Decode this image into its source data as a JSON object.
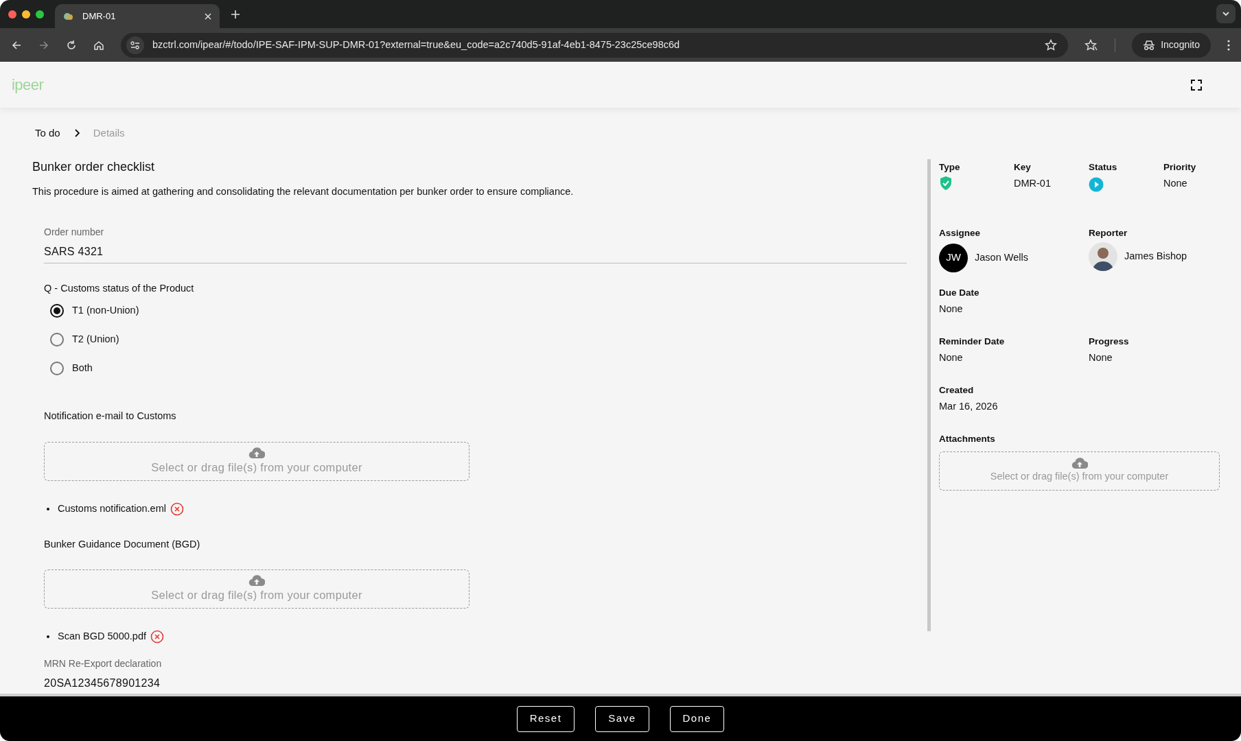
{
  "browser": {
    "tab_title": "DMR-01",
    "url": "bzctrl.com/ipear/#/todo/IPE-SAF-IPM-SUP-DMR-01?external=true&eu_code=a2c740d5-91af-4eb1-8475-23c25ce98c6d",
    "profile": "Incognito"
  },
  "app": {
    "logo": "ipeer"
  },
  "breadcrumb": [
    {
      "label": "To do",
      "current": false
    },
    {
      "label": "Details",
      "current": true
    }
  ],
  "title": "Bunker order checklist",
  "description": "This procedure is aimed at gathering and consolidating the relevant documentation per bunker order to ensure compliance.",
  "form": [
    {
      "kind": "text",
      "label": "Order number",
      "value": "SARS 4321"
    },
    {
      "kind": "radio",
      "label": "Q - Customs status of the Product",
      "options": [
        {
          "label": "T1 (non-Union)",
          "selected": true
        },
        {
          "label": "T2 (Union)",
          "selected": false
        },
        {
          "label": "Both",
          "selected": false
        }
      ]
    },
    {
      "kind": "upload",
      "label": "Notification e-mail to Customs",
      "hint": "Select or drag file(s) from your computer",
      "files": [
        "Customs notification.eml"
      ]
    },
    {
      "kind": "upload",
      "label": "Bunker Guidance Document (BGD)",
      "hint": "Select or drag file(s) from your computer",
      "files": [
        "Scan BGD 5000.pdf"
      ]
    },
    {
      "kind": "text",
      "label": "MRN Re-Export declaration",
      "value": "20SA12345678901234"
    }
  ],
  "details": {
    "type": {
      "label": "Type"
    },
    "key": {
      "label": "Key",
      "value": "DMR-01"
    },
    "status": {
      "label": "Status"
    },
    "priority": {
      "label": "Priority",
      "value": "None"
    },
    "assignee": {
      "label": "Assignee",
      "initials": "JW",
      "name": "Jason Wells"
    },
    "reporter": {
      "label": "Reporter",
      "name": "James Bishop"
    },
    "due_date": {
      "label": "Due Date",
      "value": "None"
    },
    "reminder_date": {
      "label": "Reminder Date",
      "value": "None"
    },
    "progress": {
      "label": "Progress",
      "value": "None"
    },
    "created": {
      "label": "Created",
      "value": "Mar 16, 2026"
    },
    "attachments": {
      "label": "Attachments",
      "hint": "Select or drag file(s) from your computer"
    }
  },
  "actions": [
    "Reset",
    "Save",
    "Done"
  ]
}
